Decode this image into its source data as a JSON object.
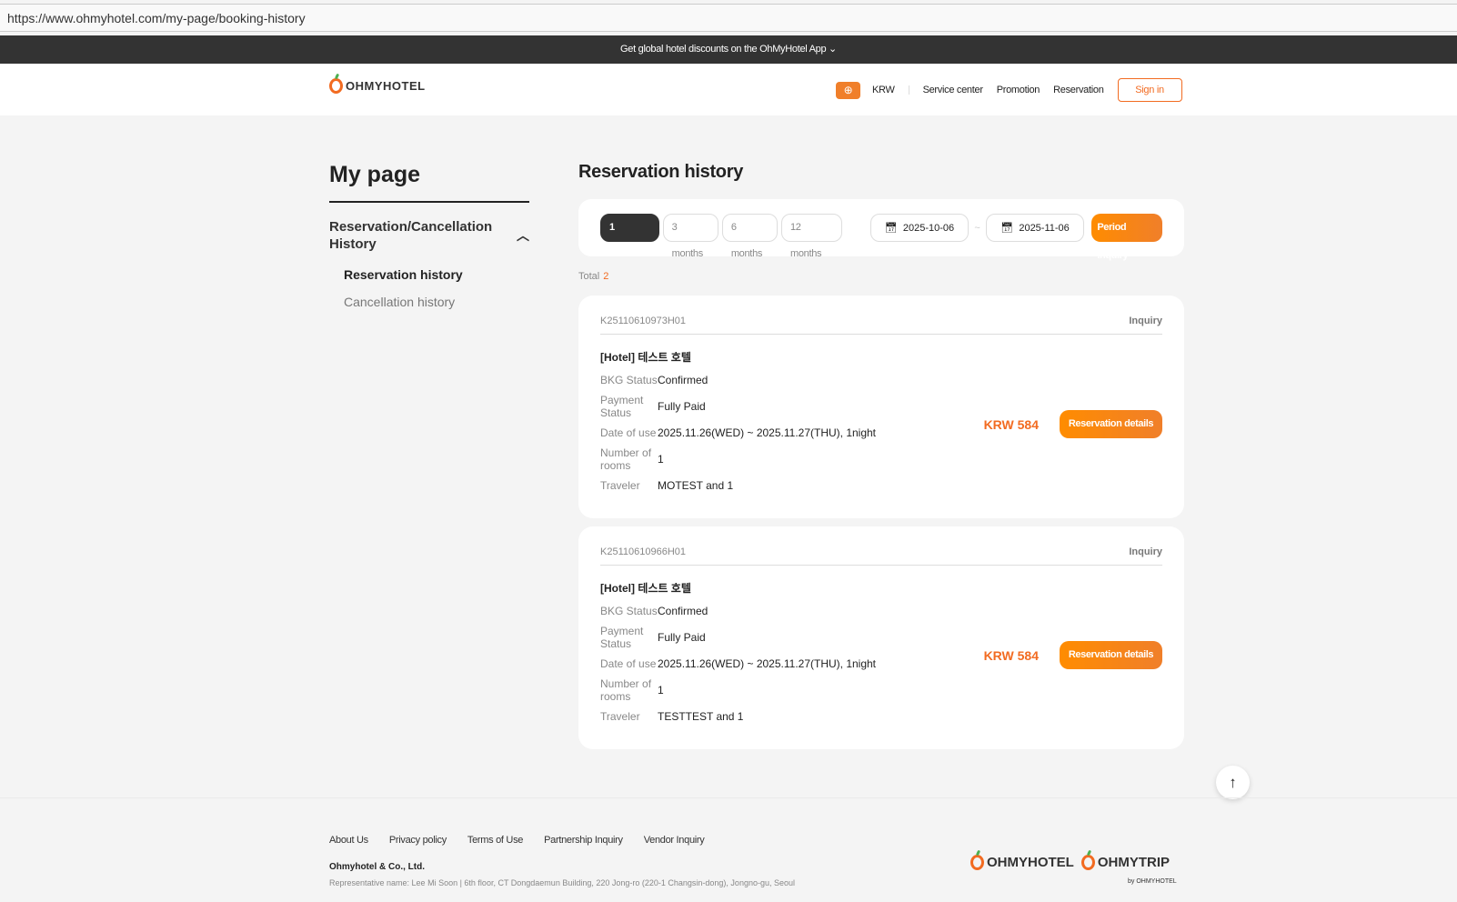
{
  "browser": {
    "url": "https://www.ohmyhotel.com/my-page/booking-history"
  },
  "promo_bar": {
    "text": "Get global hotel discounts on the OhMyHotel App"
  },
  "header": {
    "logo": "OHMYHOTEL",
    "currency": "KRW",
    "nav": [
      "Service center",
      "Promotion",
      "Reservation"
    ],
    "sign_in": "Sign in"
  },
  "sidebar": {
    "title": "My page",
    "section": "Reservation/Cancellation History",
    "items": [
      {
        "label": "Reservation history",
        "active": true
      },
      {
        "label": "Cancellation history",
        "active": false
      }
    ]
  },
  "main": {
    "title": "Reservation history",
    "periods": [
      "1 months",
      "3 months",
      "6 months",
      "12 months"
    ],
    "selected_period": "1 months",
    "start_date": "2025-10-06",
    "date_sep": "~",
    "end_date": "2025-11-06",
    "inquiry_button": "Period inquiry",
    "total_label": "Total",
    "total_count": "2",
    "labels": {
      "status": "BKG Status",
      "payment": "Payment Status",
      "date": "Date of use",
      "rooms": "Number of rooms",
      "traveler": "Traveler",
      "inquiry": "Inquiry",
      "details": "Reservation details"
    },
    "bookings": [
      {
        "id": "K25110610973H01",
        "hotel": "[Hotel] 테스트 호텔",
        "status": "Confirmed",
        "payment": "Fully Paid",
        "date": "2025.11.26(WED) ~ 2025.11.27(THU), 1night",
        "rooms": "1",
        "traveler": "MOTEST and 1",
        "price": "KRW 584"
      },
      {
        "id": "K25110610966H01",
        "hotel": "[Hotel] 테스트 호텔",
        "status": "Confirmed",
        "payment": "Fully Paid",
        "date": "2025.11.26(WED) ~ 2025.11.27(THU), 1night",
        "rooms": "1",
        "traveler": "TESTTEST and 1",
        "price": "KRW 584"
      }
    ]
  },
  "footer": {
    "links": [
      "About Us",
      "Privacy policy",
      "Terms of Use",
      "Partnership Inquiry",
      "Vendor Inquiry"
    ],
    "company": "Ohmyhotel & Co., Ltd.",
    "address": "Representative name: Lee Mi Soon  |  6th floor, CT Dongdaemun Building, 220 Jong-ro (220-1 Changsin-dong), Jongno-gu, Seoul",
    "logos": [
      "OHMYHOTEL",
      "OHMYTRIP"
    ],
    "by": "by OHMYHOTEL"
  },
  "colors": {
    "accent": "#f26b21",
    "dark": "#333333"
  }
}
